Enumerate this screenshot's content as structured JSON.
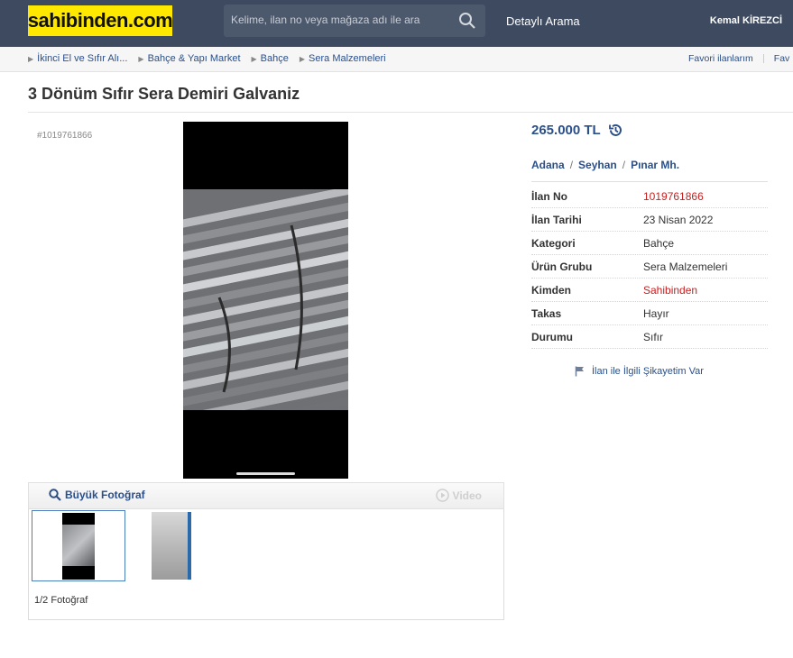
{
  "header": {
    "logo": "sahibinden.com",
    "search_placeholder": "Kelime, ilan no veya mağaza adı ile ara",
    "detailed_search": "Detaylı Arama",
    "user_name": "Kemal KİREZCİ"
  },
  "breadcrumb": {
    "items": [
      "İkinci El ve Sıfır Alı...",
      "Bahçe & Yapı Market",
      "Bahçe",
      "Sera Malzemeleri"
    ],
    "favorites": "Favori ilanlarım",
    "favorites2": "Fav"
  },
  "listing": {
    "title": "3 Dönüm Sıfır Sera Demiri Galvaniz",
    "number_tag": "#1019761866",
    "price": "265.000 TL",
    "location": {
      "city": "Adana",
      "district": "Seyhan",
      "neighborhood": "Pınar Mh.",
      "separator": "/"
    },
    "details": [
      {
        "key": "İlan No",
        "value": "1019761866",
        "accent": true
      },
      {
        "key": "İlan Tarihi",
        "value": "23 Nisan 2022",
        "accent": false
      },
      {
        "key": "Kategori",
        "value": "Bahçe",
        "accent": false
      },
      {
        "key": "Ürün Grubu",
        "value": "Sera Malzemeleri",
        "accent": false
      },
      {
        "key": "Kimden",
        "value": "Sahibinden",
        "accent": true
      },
      {
        "key": "Takas",
        "value": "Hayır",
        "accent": false
      },
      {
        "key": "Durumu",
        "value": "Sıfır",
        "accent": false
      }
    ],
    "report_link": "İlan ile İlgili Şikayetim Var"
  },
  "gallery": {
    "big_photo_label": "Büyük Fotoğraf",
    "video_label": "Video",
    "counter": "1/2 Fotoğraf"
  },
  "colors": {
    "header_bg": "#3d4a5f",
    "logo_bg": "#ffe800",
    "link_blue": "#2a4f8a",
    "accent_red": "#c81e1e"
  },
  "icons": {
    "search": "search-icon",
    "history": "price-history-icon",
    "flag": "flag-icon",
    "magnifier": "magnifier-icon",
    "play": "play-icon"
  }
}
